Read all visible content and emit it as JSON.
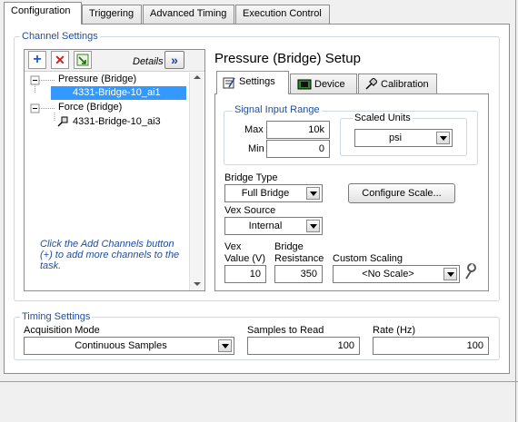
{
  "tabs": {
    "configuration": "Configuration",
    "triggering": "Triggering",
    "advanced_timing": "Advanced Timing",
    "execution_control": "Execution Control"
  },
  "channel_settings": {
    "title": "Channel Settings",
    "details_label": "Details",
    "details_glyph": "»",
    "tree": {
      "group1": "Pressure (Bridge)",
      "channel1": "4331-Bridge-10_ai1",
      "group2": "Force (Bridge)",
      "channel2": "4331-Bridge-10_ai3"
    },
    "hint": "Click the Add Channels button (+) to add more channels to the task."
  },
  "setup": {
    "title": "Pressure (Bridge) Setup",
    "tabs": {
      "settings": "Settings",
      "device": "Device",
      "calibration": "Calibration"
    },
    "signal_input_range": {
      "title": "Signal Input Range",
      "max_label": "Max",
      "max_value": "10k",
      "min_label": "Min",
      "min_value": "0"
    },
    "scaled_units": {
      "title": "Scaled Units",
      "value": "psi"
    },
    "bridge_type": {
      "label": "Bridge Type",
      "value": "Full Bridge"
    },
    "configure_scale": "Configure Scale...",
    "vex_source": {
      "label": "Vex Source",
      "value": "Internal"
    },
    "vex_value": {
      "label1": "Vex",
      "label2": "Value (V)",
      "value": "10"
    },
    "bridge_resistance": {
      "label1": "Bridge",
      "label2": "Resistance",
      "value": "350"
    },
    "custom_scaling": {
      "label": "Custom Scaling",
      "value": "<No Scale>"
    }
  },
  "timing": {
    "title": "Timing Settings",
    "acquisition_mode": {
      "label": "Acquisition Mode",
      "value": "Continuous Samples"
    },
    "samples_to_read": {
      "label": "Samples to Read",
      "value": "100"
    },
    "rate": {
      "label": "Rate (Hz)",
      "value": "100"
    }
  },
  "colors": {
    "accent": "#1f4e9c",
    "selection": "#3399ff",
    "add": "#1b5bd6",
    "remove": "#d02020"
  }
}
